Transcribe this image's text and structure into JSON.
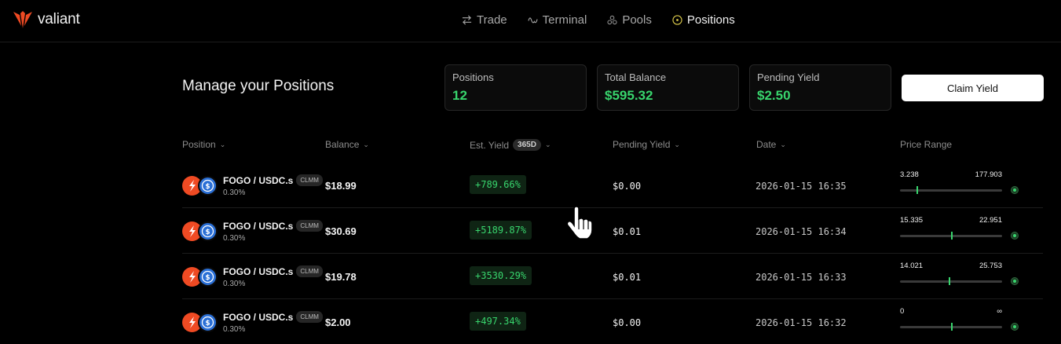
{
  "brand": {
    "name": "valiant",
    "accent": "#ef4a23"
  },
  "nav": [
    {
      "label": "Trade",
      "icon": "swap-arrows-icon",
      "active": false
    },
    {
      "label": "Terminal",
      "icon": "pulse-icon",
      "active": false
    },
    {
      "label": "Pools",
      "icon": "pools-icon",
      "active": false
    },
    {
      "label": "Positions",
      "icon": "target-icon",
      "active": true
    }
  ],
  "page": {
    "title": "Manage your Positions"
  },
  "stats": [
    {
      "label": "Positions",
      "value": "12"
    },
    {
      "label": "Total Balance",
      "value": "$595.32"
    },
    {
      "label": "Pending Yield",
      "value": "$2.50"
    }
  ],
  "claim_button": {
    "label": "Claim Yield"
  },
  "table": {
    "headers": {
      "position": "Position",
      "balance": "Balance",
      "est_yield": "Est. Yield",
      "est_yield_badge": "365D",
      "pending_yield": "Pending Yield",
      "date": "Date",
      "price_range": "Price Range"
    },
    "rows": [
      {
        "pair": "FOGO / USDC.s",
        "type": "CLMM",
        "fee": "0.30%",
        "balance": "$18.99",
        "est_yield": "+789.66%",
        "pending": "$0.00",
        "date": "2026-01-15 16:35",
        "range_low": "3.238",
        "range_high": "177.903",
        "range_position": 0.16
      },
      {
        "pair": "FOGO / USDC.s",
        "type": "CLMM",
        "fee": "0.30%",
        "balance": "$30.69",
        "est_yield": "+5189.87%",
        "pending": "$0.01",
        "date": "2026-01-15 16:34",
        "range_low": "15.335",
        "range_high": "22.951",
        "range_position": 0.5
      },
      {
        "pair": "FOGO / USDC.s",
        "type": "CLMM",
        "fee": "0.30%",
        "balance": "$19.78",
        "est_yield": "+3530.29%",
        "pending": "$0.01",
        "date": "2026-01-15 16:33",
        "range_low": "14.021",
        "range_high": "25.753",
        "range_position": 0.48
      },
      {
        "pair": "FOGO / USDC.s",
        "type": "CLMM",
        "fee": "0.30%",
        "balance": "$2.00",
        "est_yield": "+497.34%",
        "pending": "$0.00",
        "date": "2026-01-15 16:32",
        "range_low": "0",
        "range_high": "∞",
        "range_position": 0.5
      }
    ]
  },
  "colors": {
    "positive": "#38d56d",
    "background": "#000000"
  }
}
